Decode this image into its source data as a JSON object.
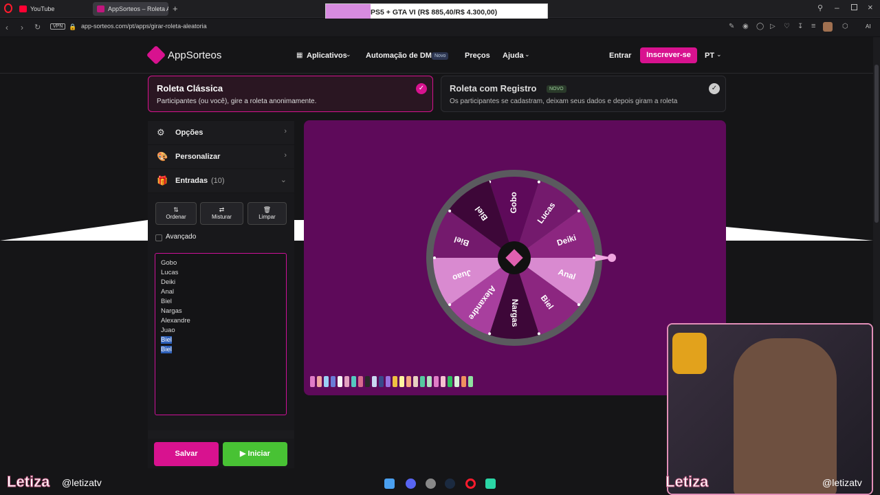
{
  "browser": {
    "tabs": [
      {
        "title": "YouTube",
        "favicon_color": "#ff0033"
      },
      {
        "title": "AppSorteos – Roleta Alea",
        "favicon_color": "#c0167d"
      }
    ],
    "url": "app-sorteos.com/pt/apps/girar-roleta-aleatoria",
    "vpn_label": "VPN",
    "banner_text": "PS5 + GTA VI (R$ 885,40/R$ 4.300,00)",
    "ai_label": "AI"
  },
  "header": {
    "logo_text": "AppSorteos",
    "menu": {
      "apps": "Aplicativos",
      "dm": "Automação de DM",
      "dm_badge": "Novo",
      "prices": "Preços",
      "help": "Ajuda"
    },
    "login": "Entrar",
    "signup": "Inscrever-se",
    "lang": "PT"
  },
  "modes": {
    "classic": {
      "title": "Roleta Clássica",
      "desc": "Participantes (ou você), gire a roleta anonimamente."
    },
    "registered": {
      "title": "Roleta com Registro",
      "badge": "NOVO",
      "desc": "Os participantes se cadastram, deixam seus dados e depois giram a roleta"
    }
  },
  "sidebar": {
    "options": "Opções",
    "customize": "Personalizar",
    "entries_label": "Entradas",
    "entries_count": "(10)",
    "tools": {
      "sort": "Ordenar",
      "shuffle": "Misturar",
      "clear": "Limpar"
    },
    "advanced": "Avançado",
    "entries": [
      "Gobo",
      "Lucas",
      "Deiki",
      "Anal",
      "Biel",
      "Nargas",
      "Alexandre",
      "Juao",
      "Biel",
      "Biel"
    ],
    "selected_entries": [
      8,
      9
    ]
  },
  "wheel": {
    "segments": [
      "Gobo",
      "Lucas",
      "Deiki",
      "Anal",
      "Biel",
      "Nargas",
      "Alexandre",
      "Juao",
      "Biel",
      "Biel"
    ],
    "colors": [
      "#5e0a5a",
      "#741a6d",
      "#8c2680",
      "#d98ad0",
      "#8c2680",
      "#3d0738",
      "#a83f9e",
      "#d98ad0",
      "#741a6d",
      "#3d0738"
    ],
    "palette": [
      "#e07cc7",
      "#f0a6a0",
      "#9ad0f5",
      "#6a7bd6",
      "#f5f5f5",
      "#e2a0c0",
      "#55c9c0",
      "#d66a8e",
      "#2a2a2a",
      "#c9d7f2",
      "#3a4a8a",
      "#9a72e0",
      "#f0c040",
      "#fff3a0",
      "#f5a880",
      "#e8d0c0",
      "#55c9a0",
      "#b0e0c0",
      "#e07cc7",
      "#f5c0d0",
      "#30c060",
      "#d8f0d8",
      "#f09060",
      "#90e0a0"
    ]
  },
  "actions": {
    "save": "Salvar",
    "start": "Iniciar"
  },
  "stream": {
    "name": "Letiza",
    "handle": "@letizatv"
  }
}
